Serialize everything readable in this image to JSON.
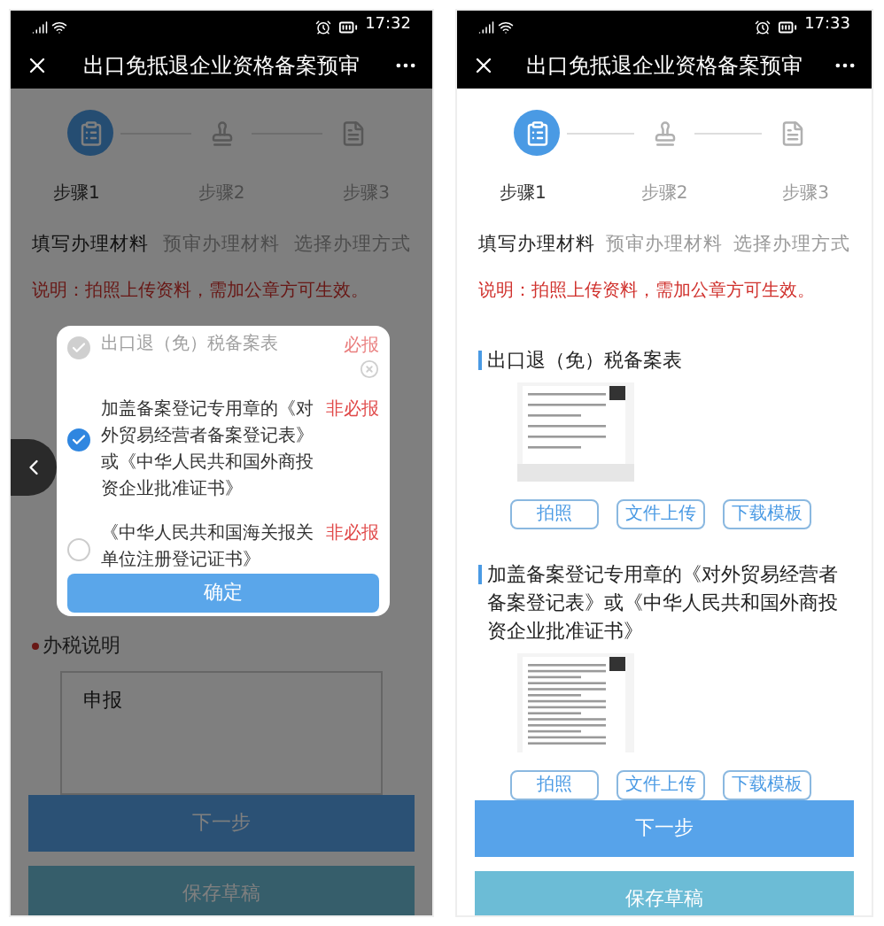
{
  "screens": [
    {
      "status_bar": {
        "time": "17:32"
      },
      "title": "出口免抵退企业资格备案预审",
      "steps": [
        {
          "label": "步骤1",
          "selected": true
        },
        {
          "label": "步骤2",
          "selected": false
        },
        {
          "label": "步骤3",
          "selected": false
        }
      ],
      "tabs": [
        {
          "label": "填写办理材料",
          "selected": true
        },
        {
          "label": "预审办理材料",
          "selected": false
        },
        {
          "label": "选择办理方式",
          "selected": false
        }
      ],
      "note": "说明：拍照上传资料，需加公章方可生效。",
      "tax_note": {
        "label": "办税说明",
        "required": true,
        "value": "申报"
      },
      "next_button": "下一步",
      "save_button": "保存草稿",
      "dialog": {
        "items": [
          {
            "label": "出口退（免）税备案表",
            "requirement": "必报",
            "checked": true,
            "disabled": true
          },
          {
            "label": "加盖备案登记专用章的《对外贸易经营者备案登记表》或《中华人民共和国外商投资企业批准证书》",
            "requirement": "非必报",
            "checked": true,
            "disabled": false
          },
          {
            "label": "《中华人民共和国海关报关单位注册登记证书》",
            "requirement": "非必报",
            "checked": false,
            "disabled": false
          }
        ],
        "confirm_button": "确定"
      }
    },
    {
      "status_bar": {
        "time": "17:33"
      },
      "title": "出口免抵退企业资格备案预审",
      "steps": [
        {
          "label": "步骤1",
          "selected": true
        },
        {
          "label": "步骤2",
          "selected": false
        },
        {
          "label": "步骤3",
          "selected": false
        }
      ],
      "tabs": [
        {
          "label": "填写办理材料",
          "selected": true
        },
        {
          "label": "预审办理材料",
          "selected": false
        },
        {
          "label": "选择办理方式",
          "selected": false
        }
      ],
      "note": "说明：拍照上传资料，需加公章方可生效。",
      "materials": [
        {
          "title": "出口退（免）税备案表",
          "buttons": [
            "拍照",
            "文件上传",
            "下载模板"
          ]
        },
        {
          "title": "加盖备案登记专用章的《对外贸易经营者备案登记表》或《中华人民共和国外商投资企业批准证书》",
          "buttons": [
            "拍照",
            "文件上传",
            "下载模板"
          ]
        }
      ],
      "next_button": "下一步",
      "save_button": "保存草稿"
    }
  ]
}
